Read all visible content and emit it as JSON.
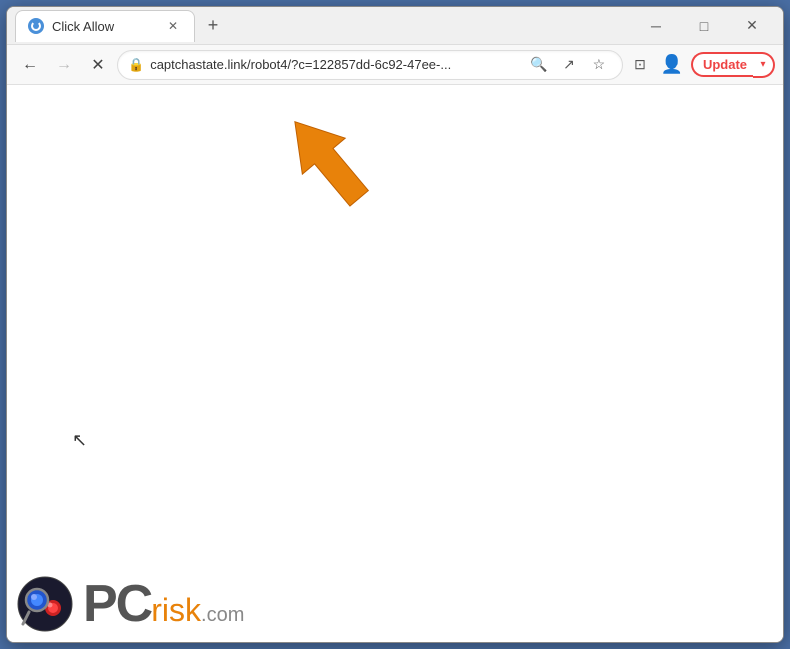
{
  "window": {
    "title": "Click Allow",
    "controls": {
      "minimize": "─",
      "maximize": "□",
      "close": "✕"
    }
  },
  "tab": {
    "title": "Click Allow",
    "close_label": "✕"
  },
  "new_tab_button": "+",
  "nav": {
    "back_label": "←",
    "forward_label": "→",
    "reload_label": "✕",
    "url": "captchastate.link/robot4/?c=122857dd-6c92-47ee-...",
    "lock_icon": "🔒"
  },
  "toolbar": {
    "search_icon": "🔍",
    "share_icon": "↗",
    "bookmark_icon": "☆",
    "tab_icon": "⊡",
    "profile_icon": "👤",
    "update_label": "Update",
    "update_menu": "▾"
  },
  "watermark": {
    "pc_text": "PC",
    "risk_text": "risk",
    "dot_com": ".com"
  }
}
